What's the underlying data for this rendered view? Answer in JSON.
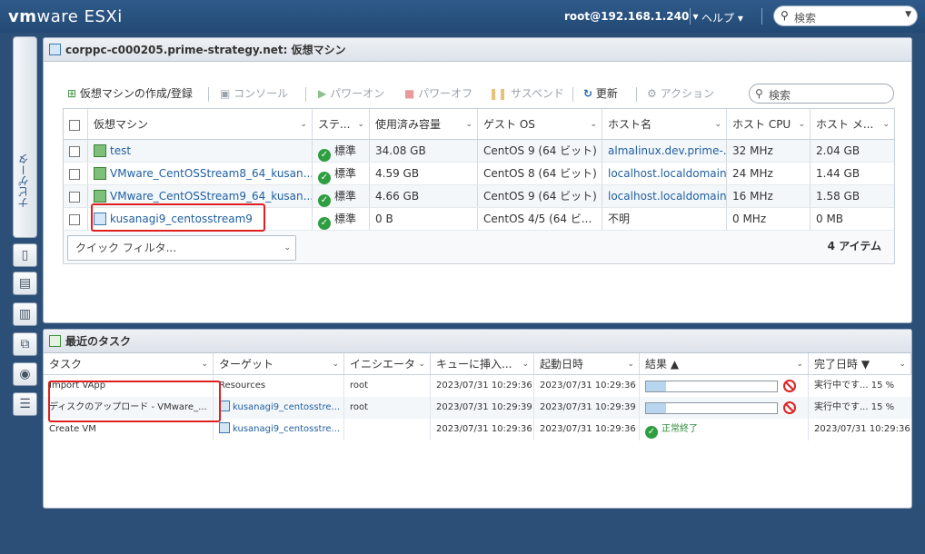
{
  "topbar": {
    "brand": "vm",
    "brand_suffix": "ware",
    "product": "ESXi",
    "user": "root@192.168.1.240 ▾",
    "help": "ヘルプ ▾",
    "search_placeholder": "検索"
  },
  "sidenav": {
    "label": "ナビゲータ"
  },
  "vm_panel": {
    "title": "corppc-c000205.prime-strategy.net: 仮想マシン",
    "toolbar": {
      "create": "仮想マシンの作成/登録",
      "console": "コンソール",
      "power_on": "パワーオン",
      "power_off": "パワーオフ",
      "suspend": "サスペンド",
      "refresh": "更新",
      "actions": "アクション"
    },
    "search_placeholder": "検索",
    "columns": [
      "仮想マシン",
      "ステ...",
      "使用済み容量",
      "ゲスト OS",
      "ホスト名",
      "ホスト CPU",
      "ホスト メ..."
    ],
    "rows": [
      {
        "name": "test",
        "state": "標準",
        "used": "34.08 GB",
        "os": "CentOS 9 (64 ビット)",
        "host": "almalinux.dev.prime-...",
        "cpu": "32 MHz",
        "mem": "2.04 GB"
      },
      {
        "name": "VMware_CentOSStream8_64_kusan...",
        "state": "標準",
        "used": "4.59 GB",
        "os": "CentOS 8 (64 ビット)",
        "host": "localhost.localdomain",
        "cpu": "24 MHz",
        "mem": "1.44 GB"
      },
      {
        "name": "VMware_CentOSStream9_64_kusan...",
        "state": "標準",
        "used": "4.66 GB",
        "os": "CentOS 9 (64 ビット)",
        "host": "localhost.localdomain",
        "cpu": "16 MHz",
        "mem": "1.58 GB"
      },
      {
        "name": "kusanagi9_centosstream9",
        "state": "標準",
        "used": "0 B",
        "os": "CentOS 4/5 (64 ビ...",
        "host": "不明",
        "cpu": "0 MHz",
        "mem": "0 MB"
      }
    ],
    "quick_filter": "クイック フィルタ...",
    "count": "4 アイテム"
  },
  "tasks_panel": {
    "title": "最近のタスク",
    "columns": [
      "タスク",
      "ターゲット",
      "イニシエータ",
      "キューに挿入...",
      "起動日時",
      "結果 ▲",
      "完了日時 ▼"
    ],
    "rows": [
      {
        "task": "Import VApp",
        "target": "Resources",
        "initiator": "root",
        "queued": "2023/07/31 10:29:36",
        "started": "2023/07/31 10:29:36",
        "progress": 15,
        "completed": "実行中です... 15 %"
      },
      {
        "task": "ディスクのアップロード - VMware_...",
        "target": "kusanagi9_centosstre...",
        "initiator": "root",
        "queued": "2023/07/31 10:29:39",
        "started": "2023/07/31 10:29:39",
        "progress": 15,
        "completed": "実行中です... 15 %"
      },
      {
        "task": "Create VM",
        "target": "kusanagi9_centosstre...",
        "initiator": "",
        "queued": "2023/07/31 10:29:36",
        "started": "2023/07/31 10:29:36",
        "result": "正常終了",
        "completed": "2023/07/31 10:29:36"
      }
    ]
  }
}
